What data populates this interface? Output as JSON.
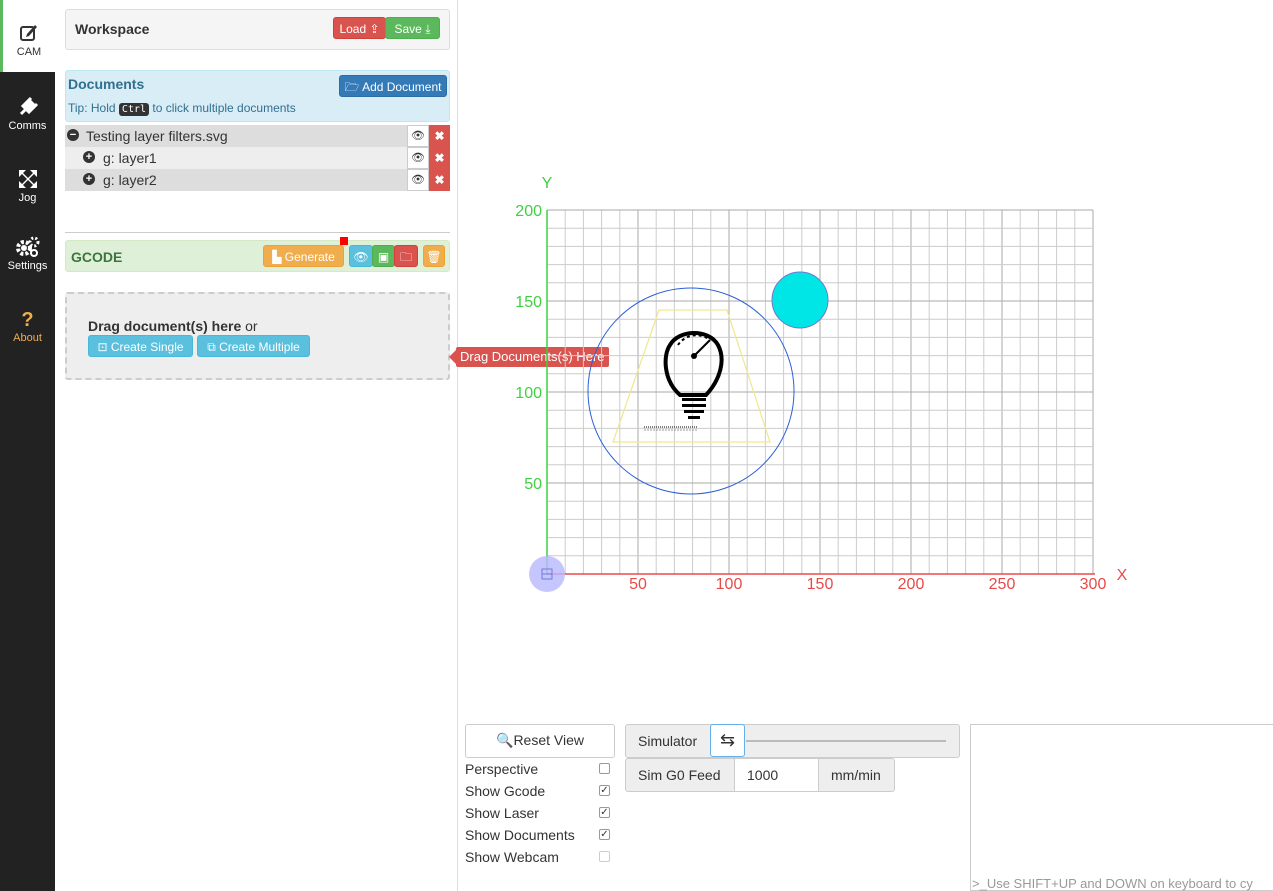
{
  "nav": {
    "items": [
      {
        "label": "CAM",
        "icon": "edit-icon",
        "active": true
      },
      {
        "label": "Comms",
        "icon": "plug-icon"
      },
      {
        "label": "Jog",
        "icon": "arrows-icon"
      },
      {
        "label": "Settings",
        "icon": "gears-icon"
      },
      {
        "label": "About",
        "icon": "question-icon"
      }
    ]
  },
  "workspace": {
    "title": "Workspace",
    "load_label": "Load",
    "save_label": "Save"
  },
  "documents": {
    "title": "Documents",
    "add_label": "Add Document",
    "tip_before": "Tip: Hold",
    "tip_key": "Ctrl",
    "tip_after": "to click multiple documents",
    "tree": [
      {
        "label": "Testing layer filters.svg",
        "expander": "minus"
      },
      {
        "label": "g: layer1",
        "expander": "plus"
      },
      {
        "label": "g: layer2",
        "expander": "plus"
      }
    ]
  },
  "gcode": {
    "title": "GCODE",
    "generate_label": "Generate"
  },
  "dropzone": {
    "text_bold": "Drag document(s) here",
    "text_rest": " or",
    "create_single": "Create Single",
    "create_multiple": "Create Multiple",
    "tooltip": "Drag Documents(s) Here"
  },
  "viewport": {
    "x_axis_label": "X",
    "y_axis_label": "Y",
    "x_ticks": [
      "50",
      "100",
      "150",
      "200",
      "250",
      "300"
    ],
    "y_ticks": [
      "200",
      "150",
      "100",
      "50"
    ],
    "axis_x_color": "#e84a4a",
    "axis_y_color": "#3fd13f",
    "grid_color": "#cccccc",
    "circle_color": "#2b5fd9",
    "dot_color": "#00e5e5",
    "trapezoid_color": "#f2e68c"
  },
  "controls": {
    "reset_view": "Reset View",
    "simulator": "Simulator",
    "sim_feed_label": "Sim G0 Feed",
    "sim_feed_value": "1000",
    "sim_feed_unit": "mm/min",
    "options": [
      {
        "label": "Perspective",
        "checked": false
      },
      {
        "label": "Show Gcode",
        "checked": true
      },
      {
        "label": "Show Laser",
        "checked": true
      },
      {
        "label": "Show Documents",
        "checked": true
      },
      {
        "label": "Show Webcam",
        "checked": false
      }
    ]
  },
  "console": {
    "prompt": "Use SHIFT+UP and DOWN on keyboard to cy"
  }
}
